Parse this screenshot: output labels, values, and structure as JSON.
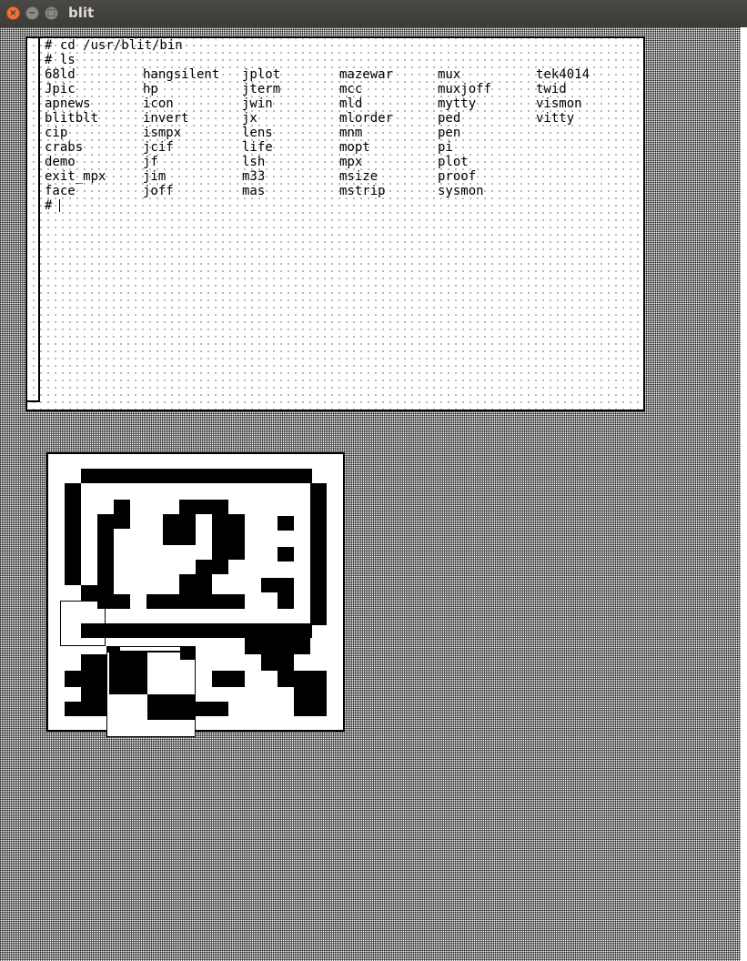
{
  "window": {
    "title": "blit",
    "close_glyph": "×",
    "minimize_glyph": "−",
    "maximize_glyph": "□"
  },
  "terminal": {
    "lines": [
      "# cd /usr/blit/bin",
      "# ls"
    ],
    "listing": [
      [
        "68ld",
        "hangsilent",
        "jplot",
        "mazewar",
        "mux",
        "tek4014"
      ],
      [
        "Jpic",
        "hp",
        "jterm",
        "mcc",
        "muxjoff",
        "twid"
      ],
      [
        "apnews",
        "icon",
        "jwin",
        "mld",
        "mytty",
        "vismon"
      ],
      [
        "blitblt",
        "invert",
        "jx",
        "mlorder",
        "ped",
        "vitty"
      ],
      [
        "cip",
        "ismpx",
        "lens",
        "mnm",
        "pen",
        ""
      ],
      [
        "crabs",
        "jcif",
        "life",
        "mopt",
        "pi",
        ""
      ],
      [
        "demo",
        "jf",
        "lsh",
        "mpx",
        "plot",
        ""
      ],
      [
        "exit_mpx",
        "jim",
        "m33",
        "msize",
        "proof",
        ""
      ],
      [
        "face",
        "joff",
        "mas",
        "mstrip",
        "sysmon",
        ""
      ]
    ],
    "prompt": "#"
  },
  "icons": {
    "close": "close-icon",
    "minimize": "minimize-icon",
    "maximize": "maximize-icon"
  },
  "colors": {
    "titlebar": "#3c3b37",
    "close_button": "#f0703c",
    "ink": "#000000",
    "paper": "#ffffff"
  }
}
